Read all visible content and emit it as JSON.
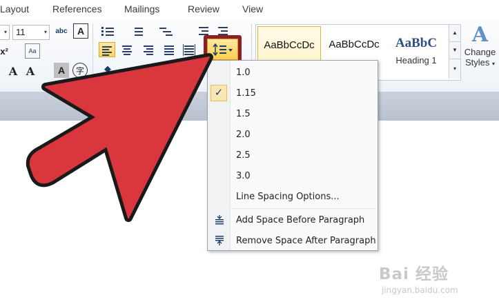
{
  "tabs": [
    "Layout",
    "References",
    "Mailings",
    "Review",
    "View"
  ],
  "font": {
    "size": "11"
  },
  "ribbon": {
    "change_case_glyph": "Aa",
    "numbering_glyph": "abc",
    "bigA": "A",
    "superscript": "x²",
    "font_grow": "A",
    "font_shrink": "A",
    "char_shade": "A",
    "enclose": "字"
  },
  "styles": {
    "tiles": [
      {
        "sample": "AaBbCcDc",
        "name": ""
      },
      {
        "sample": "AaBbCcDc",
        "name": ""
      },
      {
        "sample": "AaBbC",
        "name": "Heading 1"
      }
    ],
    "change_big": "A",
    "change_label_1": "Change",
    "change_label_2": "Styles"
  },
  "menu": {
    "items": [
      "1.0",
      "1.15",
      "1.5",
      "2.0",
      "2.5",
      "3.0",
      "Line Spacing Options..."
    ],
    "checked_index": 1,
    "check_glyph": "✓",
    "add_space": "Add Space Before Paragraph",
    "remove_space": "Remove Space After Paragraph"
  },
  "watermark": {
    "logo": "Bai  经验",
    "url": "jingyan.baidu.com"
  },
  "colors": {
    "arrow_fill": "#d9363e",
    "arrow_outline": "#1a1a1a",
    "highlight_border": "#8e1f26"
  },
  "icons": {
    "line_spacing_icon": "line-spacing-icon",
    "dropdown_arrow": "▾"
  }
}
